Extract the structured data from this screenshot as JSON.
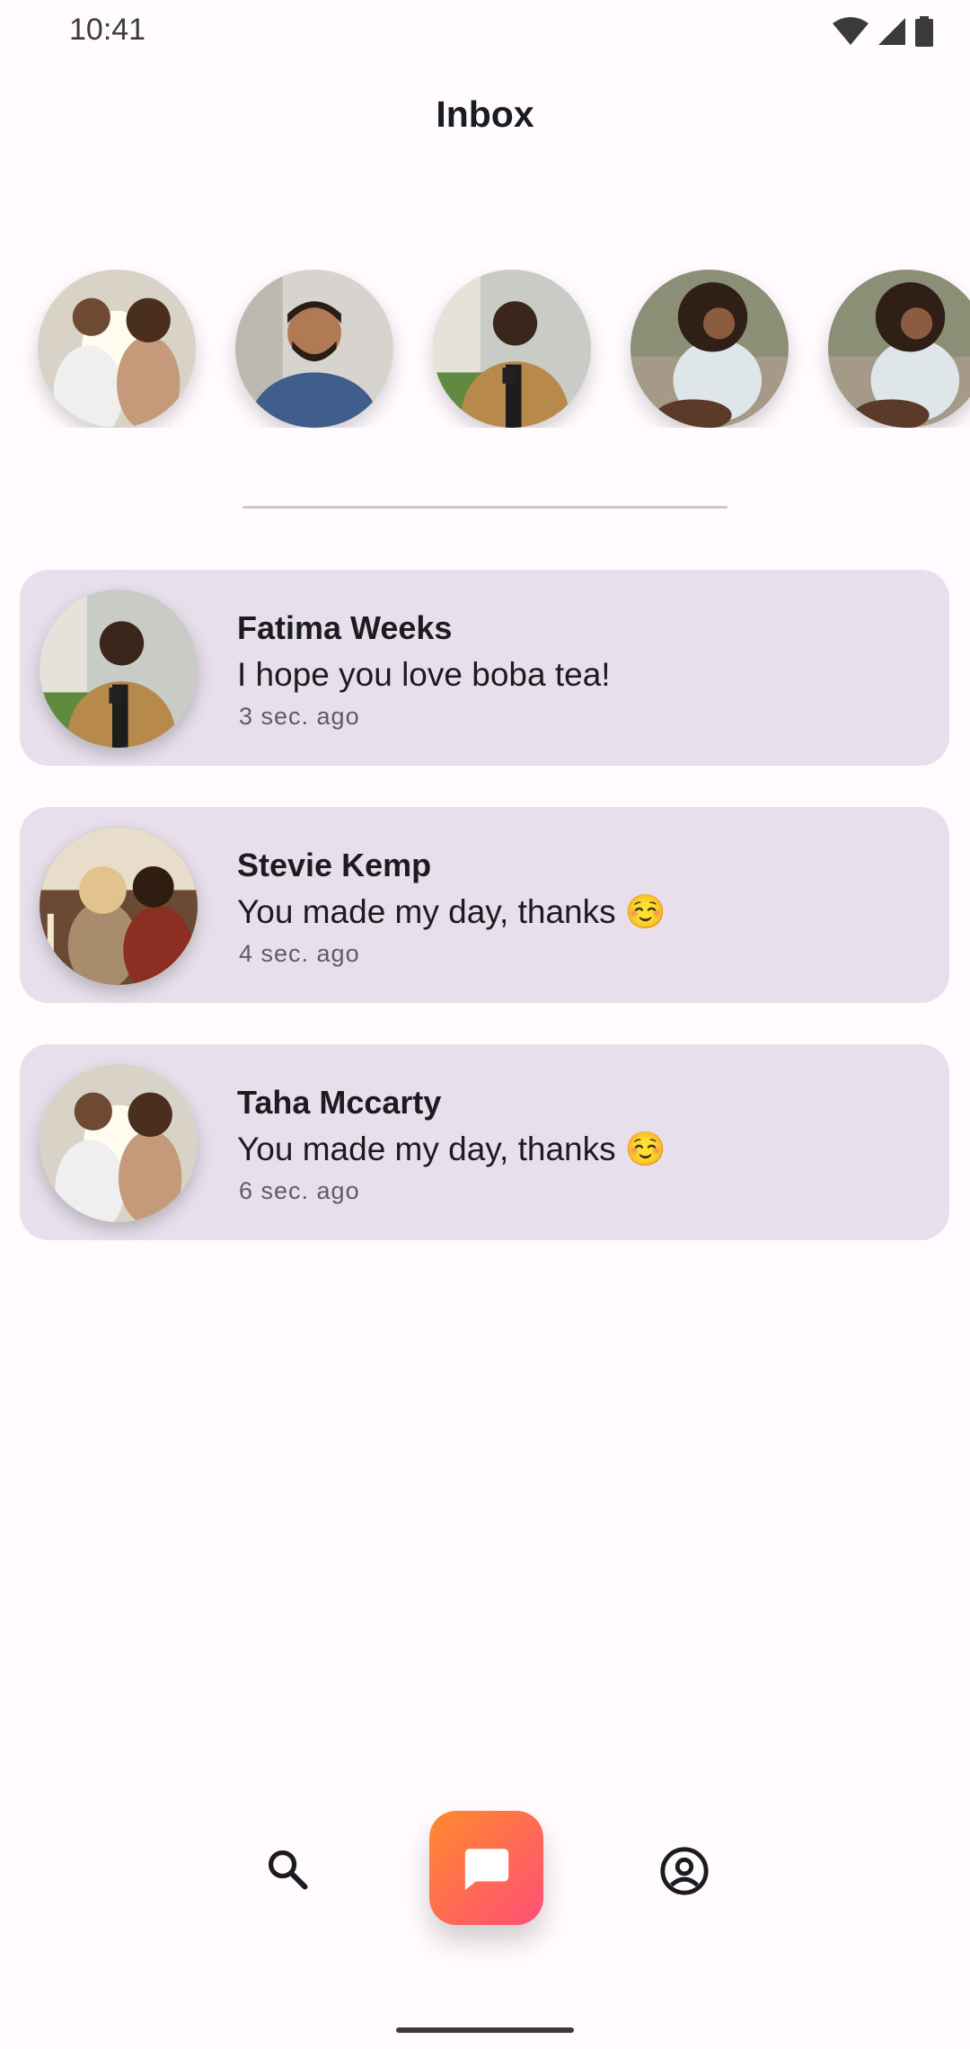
{
  "status_bar": {
    "time": "10:41",
    "icons": [
      "wifi-icon",
      "signal-icon",
      "battery-icon"
    ]
  },
  "header": {
    "title": "Inbox"
  },
  "stories": [
    {
      "avatar": "couple-photo-avatar"
    },
    {
      "avatar": "smiling-man-photo-avatar"
    },
    {
      "avatar": "man-with-phone-photo-avatar"
    },
    {
      "avatar": "woman-sitting-photo-avatar"
    },
    {
      "avatar": "woman-sitting-photo-avatar"
    }
  ],
  "messages": [
    {
      "name": "Fatima Weeks",
      "text": "I hope you love boba tea!",
      "time": "3 sec. ago",
      "avatar": "man-with-phone-photo-avatar"
    },
    {
      "name": "Stevie Kemp",
      "text": "You made my day, thanks ☺️",
      "time": "4 sec. ago",
      "avatar": "couple-dining-photo-avatar"
    },
    {
      "name": "Taha Mccarty",
      "text": "You made my day, thanks ☺️",
      "time": "6 sec. ago",
      "avatar": "couple-photo-avatar"
    }
  ],
  "bottom_nav": {
    "items": [
      {
        "icon": "search-icon"
      },
      {
        "icon": "chat-icon",
        "active": true
      },
      {
        "icon": "account-circle-icon"
      }
    ],
    "accent_gradient": [
      "#FF8A2B",
      "#FF4F78"
    ]
  },
  "colors": {
    "background": "#FFFBFE",
    "card": "#E7E0EC",
    "text": "#1C1B1F",
    "muted": "#5F5B66"
  }
}
